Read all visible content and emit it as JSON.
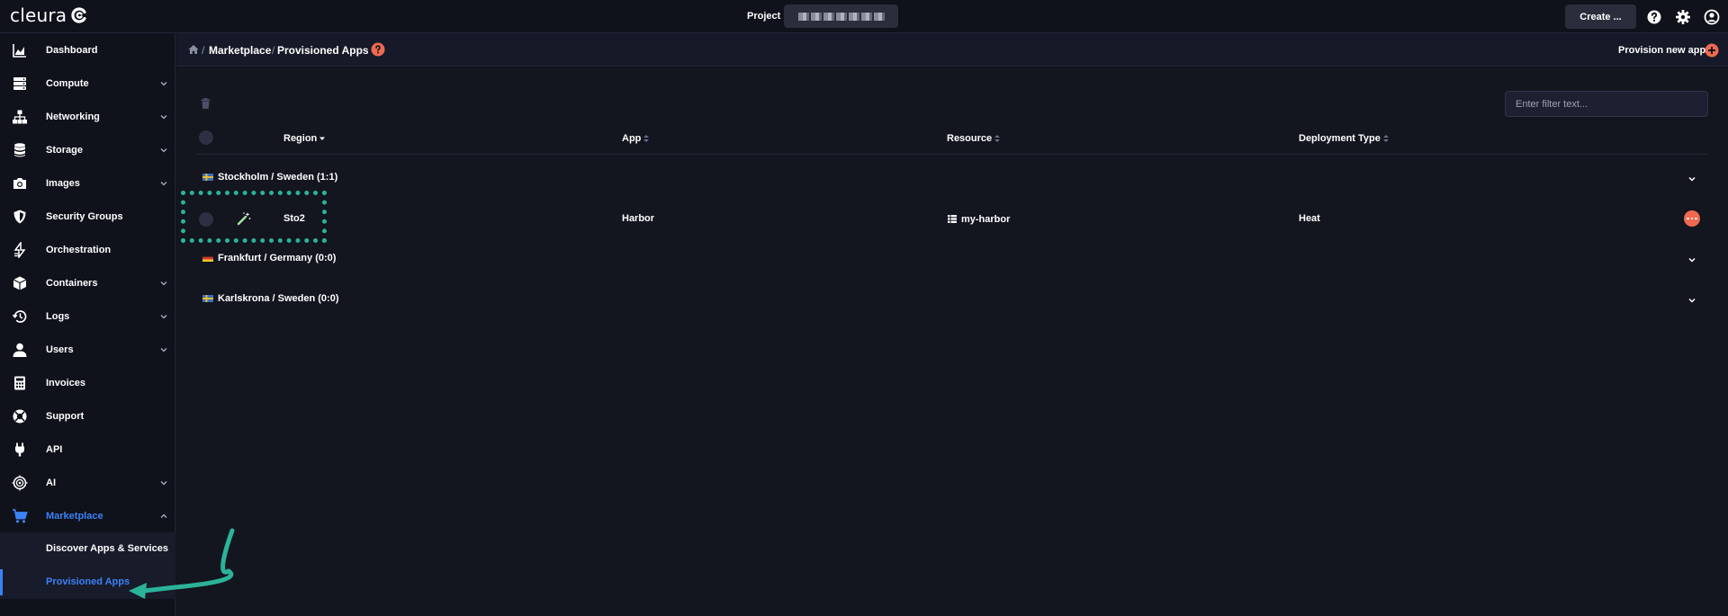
{
  "brand": {
    "name": "cleura"
  },
  "topbar": {
    "project_label": "Project",
    "create_label": "Create ..."
  },
  "sidebar": {
    "items": [
      {
        "label": "Dashboard",
        "icon": "chart-area-icon",
        "has_chevron": false
      },
      {
        "label": "Compute",
        "icon": "server-icon",
        "has_chevron": true
      },
      {
        "label": "Networking",
        "icon": "network-icon",
        "has_chevron": true
      },
      {
        "label": "Storage",
        "icon": "database-icon",
        "has_chevron": true
      },
      {
        "label": "Images",
        "icon": "camera-icon",
        "has_chevron": true
      },
      {
        "label": "Security Groups",
        "icon": "shield-icon",
        "has_chevron": false
      },
      {
        "label": "Orchestration",
        "icon": "orchestration-icon",
        "has_chevron": false
      },
      {
        "label": "Containers",
        "icon": "box-icon",
        "has_chevron": true
      },
      {
        "label": "Logs",
        "icon": "history-icon",
        "has_chevron": true
      },
      {
        "label": "Users",
        "icon": "user-icon",
        "has_chevron": true
      },
      {
        "label": "Invoices",
        "icon": "calculator-icon",
        "has_chevron": false
      },
      {
        "label": "Support",
        "icon": "lifebuoy-icon",
        "has_chevron": false
      },
      {
        "label": "API",
        "icon": "plug-icon",
        "has_chevron": false
      },
      {
        "label": "AI",
        "icon": "ai-icon",
        "has_chevron": true
      },
      {
        "label": "Marketplace",
        "icon": "cart-icon",
        "has_chevron": true,
        "expanded": true,
        "active": true
      }
    ],
    "sub_items": [
      {
        "label": "Discover Apps & Services",
        "active": false
      },
      {
        "label": "Provisioned Apps",
        "active": true
      }
    ]
  },
  "breadcrumb": {
    "items": [
      "Marketplace",
      "Provisioned Apps"
    ],
    "separator": "/",
    "provision_label": "Provision new app"
  },
  "filter": {
    "placeholder": "Enter filter text..."
  },
  "table": {
    "columns": [
      "Region",
      "App",
      "Resource",
      "Deployment Type"
    ],
    "groups": [
      {
        "label": "Stockholm / Sweden (1:1)",
        "flag": "sweden"
      },
      {
        "label": "Frankfurt / Germany (0:0)",
        "flag": "germany"
      },
      {
        "label": "Karlskrona / Sweden (0:0)",
        "flag": "sweden"
      }
    ],
    "rows": [
      {
        "region": "Sto2",
        "app": "Harbor",
        "resource": "my-harbor",
        "deployment_type": "Heat"
      }
    ]
  },
  "colors": {
    "accent": "#3b82f6",
    "action": "#ef6a51",
    "highlight": "#2bb39a"
  }
}
